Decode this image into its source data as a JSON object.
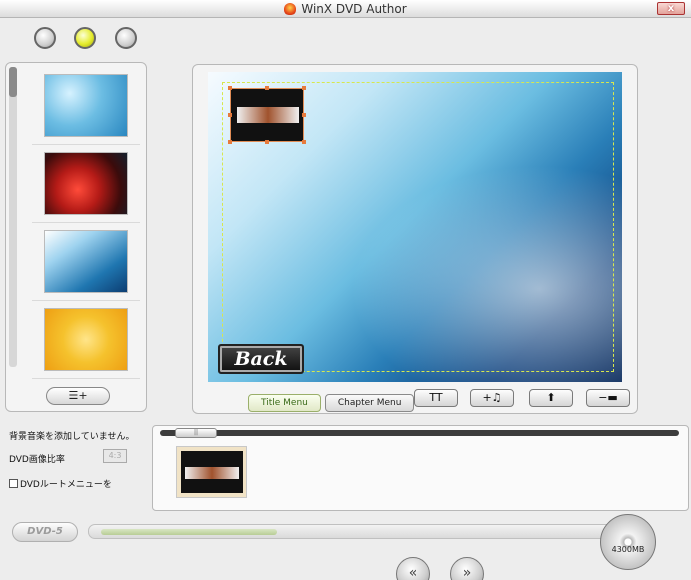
{
  "window": {
    "title": "WinX DVD Author",
    "close_label": "x"
  },
  "templates": {
    "items": [
      {
        "name": "ice-blue"
      },
      {
        "name": "red-flowers"
      },
      {
        "name": "blue-swirl"
      },
      {
        "name": "yellow-bubbles"
      }
    ],
    "add_button_icon": "menu-add-icon"
  },
  "preview": {
    "back_label": "Back",
    "tabs": [
      {
        "label": "Title Menu",
        "active": true
      },
      {
        "label": "Chapter Menu",
        "active": false
      }
    ],
    "tools": [
      {
        "icon": "text-icon",
        "label": "TT"
      },
      {
        "icon": "music-add-icon",
        "label": "+♫"
      },
      {
        "icon": "up-arrow-icon",
        "label": "⬆"
      },
      {
        "icon": "remove-icon",
        "label": "−▬"
      }
    ]
  },
  "info": {
    "bgm_status": "背景音楽を添加していません。",
    "aspect_label": "DVD画像比率",
    "aspect_value": "4:3",
    "root_menu_label": "DVDルートメニューを"
  },
  "chapters": {
    "scroll_label": "||"
  },
  "status": {
    "disc_type": "DVD-5",
    "capacity_label": "4300MB",
    "capacity_used_fraction": 0.33,
    "prev_label": "«",
    "next_label": "»"
  }
}
